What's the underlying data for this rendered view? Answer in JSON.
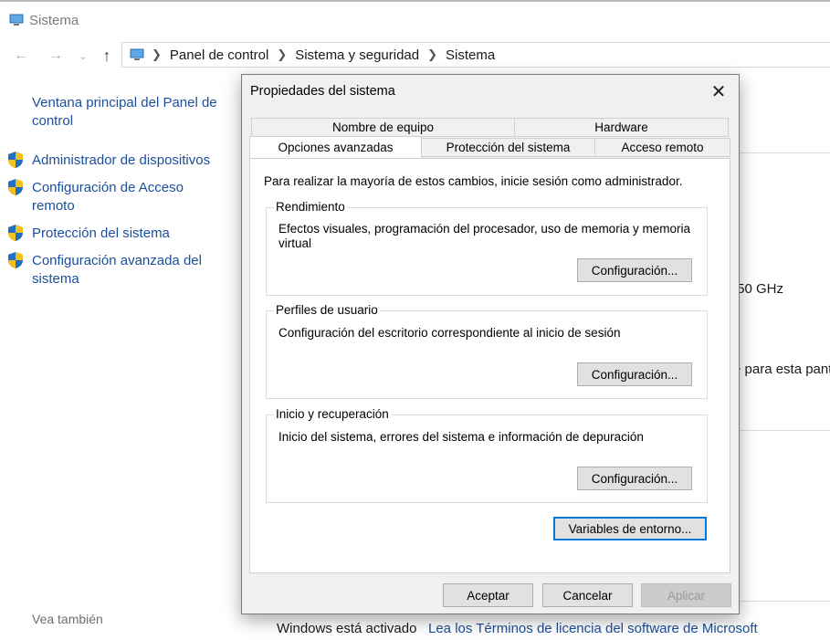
{
  "window": {
    "title": "Sistema"
  },
  "breadcrumb": [
    "Panel de control",
    "Sistema y seguridad",
    "Sistema"
  ],
  "sidebar": {
    "items": [
      {
        "label": "Ventana principal del Panel de control",
        "shield": false
      },
      {
        "label": "Administrador de dispositivos",
        "shield": true
      },
      {
        "label": "Configuración de Acceso remoto",
        "shield": true
      },
      {
        "label": "Protección del sistema",
        "shield": true
      },
      {
        "label": "Configuración avanzada del sistema",
        "shield": true
      }
    ],
    "see_also": "Vea también"
  },
  "background": {
    "processor_fragment": ".50 GHz",
    "pen_fragment": "e para esta pant",
    "activation": "Windows está activado",
    "license_link": "Lea los Términos de licencia del software de Microsoft"
  },
  "dialog": {
    "title": "Propiedades del sistema",
    "tabs_row1": [
      "Nombre de equipo",
      "Hardware"
    ],
    "tabs_row2": [
      "Opciones avanzadas",
      "Protección del sistema",
      "Acceso remoto"
    ],
    "active_tab": "Opciones avanzadas",
    "admin_note": "Para realizar la mayoría de estos cambios, inicie sesión como administrador.",
    "groups": [
      {
        "label": "Rendimiento",
        "text": "Efectos visuales, programación del procesador, uso de memoria y memoria virtual",
        "button": "Configuración..."
      },
      {
        "label": "Perfiles de usuario",
        "text": "Configuración del escritorio correspondiente al inicio de sesión",
        "button": "Configuración..."
      },
      {
        "label": "Inicio y recuperación",
        "text": "Inicio del sistema, errores del sistema e información de depuración",
        "button": "Configuración..."
      }
    ],
    "env_button": "Variables de entorno...",
    "ok": "Aceptar",
    "cancel": "Cancelar",
    "apply": "Aplicar"
  },
  "colors": {
    "link": "#1b4f9a",
    "focus": "#0078d7",
    "dialog_bg": "#f0f0f0"
  }
}
